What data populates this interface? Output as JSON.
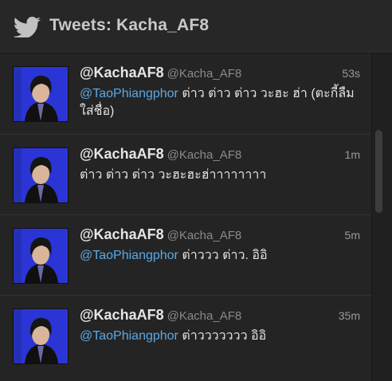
{
  "header": {
    "title": "Tweets: Kacha_AF8",
    "icon": "twitter-bird-icon"
  },
  "colors": {
    "mention": "#5aa9e6",
    "avatar_bg": "#2b35d6",
    "background": "#242424"
  },
  "tweets": [
    {
      "name": "@KachaAF8",
      "handle": "@Kacha_AF8",
      "time": "53s",
      "mention": "@TaoPhiangphor",
      "text": " ต่าว ต่าว ต่าว วะฮะ ฮ่า (ตะกี้ลืมใส่ชื่อ)"
    },
    {
      "name": "@KachaAF8",
      "handle": "@Kacha_AF8",
      "time": "1m",
      "mention": "",
      "text": "ต่าว ต่าว ต่าว วะฮะฮะฮ่าาาาาาาา"
    },
    {
      "name": "@KachaAF8",
      "handle": "@Kacha_AF8",
      "time": "5m",
      "mention": "@TaoPhiangphor",
      "text": " ต่าววว ต่าว. อิอิ"
    },
    {
      "name": "@KachaAF8",
      "handle": "@Kacha_AF8",
      "time": "35m",
      "mention": "@TaoPhiangphor",
      "text": " ต่าววววววว อิอิ"
    }
  ]
}
